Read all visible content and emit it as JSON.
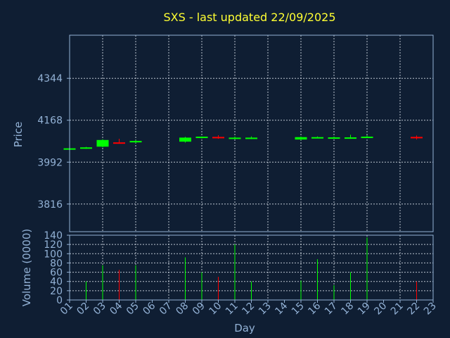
{
  "chart_data": [
    {
      "type": "candlestick",
      "title": "SXS - last updated 22/09/2025",
      "ylabel": "Price",
      "yticks": [
        "4344",
        "4168",
        "3992",
        "3816"
      ],
      "ytick_values": [
        4344,
        4168,
        3992,
        3816
      ],
      "ylim": [
        3700,
        4525
      ],
      "xlim": [
        1,
        23
      ],
      "grid": true,
      "colors": {
        "up": "#00ff00",
        "down": "#ff0000",
        "grid": "#d8e0ea",
        "axis": "#93b2d6",
        "background": "#0f1e33",
        "title": "#ffff33"
      },
      "candles": [
        {
          "day": 1,
          "open": 4050,
          "high": 4050,
          "low": 4050,
          "close": 4050
        },
        {
          "day": 2,
          "open": 4050,
          "high": 4056,
          "low": 4048,
          "close": 4054
        },
        {
          "day": 3,
          "open": 4057,
          "high": 4088,
          "low": 4054,
          "close": 4085
        },
        {
          "day": 4,
          "open": 4075,
          "high": 4090,
          "low": 4070,
          "close": 4073
        },
        {
          "day": 5,
          "open": 4075,
          "high": 4085,
          "low": 4072,
          "close": 4081
        },
        {
          "day": 8,
          "open": 4078,
          "high": 4098,
          "low": 4074,
          "close": 4095
        },
        {
          "day": 9,
          "open": 4094,
          "high": 4100,
          "low": 4091,
          "close": 4099
        },
        {
          "day": 10,
          "open": 4098,
          "high": 4105,
          "low": 4090,
          "close": 4094
        },
        {
          "day": 11,
          "open": 4092,
          "high": 4100,
          "low": 4088,
          "close": 4095
        },
        {
          "day": 12,
          "open": 4092,
          "high": 4100,
          "low": 4089,
          "close": 4095
        },
        {
          "day": 15,
          "open": 4087,
          "high": 4100,
          "low": 4084,
          "close": 4097
        },
        {
          "day": 16,
          "open": 4094,
          "high": 4100,
          "low": 4092,
          "close": 4097
        },
        {
          "day": 17,
          "open": 4093,
          "high": 4100,
          "low": 4090,
          "close": 4096
        },
        {
          "day": 18,
          "open": 4093,
          "high": 4107,
          "low": 4090,
          "close": 4096
        },
        {
          "day": 19,
          "open": 4096,
          "high": 4105,
          "low": 4093,
          "close": 4099
        },
        {
          "day": 22,
          "open": 4098,
          "high": 4104,
          "low": 4087,
          "close": 4092
        }
      ]
    },
    {
      "type": "bar",
      "xlabel": "Day",
      "ylabel": "Volume (0000)",
      "yticks": [
        "0",
        "20",
        "40",
        "60",
        "80",
        "100",
        "120",
        "140"
      ],
      "ytick_values": [
        0,
        20,
        40,
        60,
        80,
        100,
        120,
        140
      ],
      "ylim": [
        0,
        140
      ],
      "xticks": [
        "01",
        "02",
        "03",
        "04",
        "05",
        "06",
        "07",
        "08",
        "09",
        "10",
        "11",
        "12",
        "13",
        "14",
        "15",
        "16",
        "17",
        "18",
        "19",
        "20",
        "21",
        "22",
        "23"
      ],
      "xlim": [
        1,
        23
      ],
      "volumes": [
        {
          "day": 2,
          "value": 40,
          "dir": "up"
        },
        {
          "day": 3,
          "value": 75,
          "dir": "up"
        },
        {
          "day": 4,
          "value": 65,
          "dir": "down"
        },
        {
          "day": 5,
          "value": 75,
          "dir": "up"
        },
        {
          "day": 8,
          "value": 92,
          "dir": "up"
        },
        {
          "day": 9,
          "value": 60,
          "dir": "up"
        },
        {
          "day": 10,
          "value": 50,
          "dir": "down"
        },
        {
          "day": 11,
          "value": 120,
          "dir": "up"
        },
        {
          "day": 12,
          "value": 40,
          "dir": "up"
        },
        {
          "day": 15,
          "value": 42,
          "dir": "up"
        },
        {
          "day": 16,
          "value": 88,
          "dir": "up"
        },
        {
          "day": 17,
          "value": 32,
          "dir": "up"
        },
        {
          "day": 18,
          "value": 60,
          "dir": "up"
        },
        {
          "day": 19,
          "value": 135,
          "dir": "up"
        },
        {
          "day": 22,
          "value": 40,
          "dir": "down"
        }
      ]
    }
  ]
}
